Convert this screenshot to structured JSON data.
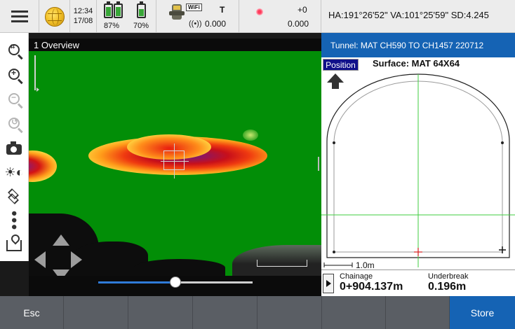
{
  "statusbar": {
    "time": "12:34",
    "date": "17/08",
    "battery1": {
      "label": "87%",
      "level": 0.87
    },
    "battery2": {
      "label": "70%",
      "level": 0.7
    },
    "wifi_tag": "WiFi",
    "t_label": "T",
    "t_value": "0.000",
    "plus_label": "+0",
    "offset_value": "0.000",
    "angles": "HA:191°26'52\"  VA:101°25'59\"  SD:4.245"
  },
  "toolbar": {
    "icons": [
      "zoom-extents-icon",
      "zoom-in-icon",
      "zoom-out-icon",
      "zoom-previous-icon",
      "camera-icon",
      "brightness-icon",
      "layers-icon",
      "more-icon",
      "map-icon"
    ]
  },
  "viewport": {
    "title": "1 Overview",
    "slider_value": 0.5
  },
  "right_panel": {
    "tunnel_title": "Tunnel: MAT CH590 TO CH1457 220712",
    "position_button": "Position",
    "surface_label": "Surface: MAT 64X64",
    "scale_label": "1.0m",
    "chainage_label": "Chainage",
    "chainage_value": "0+904.137m",
    "underbreak_label": "Underbreak",
    "underbreak_value": "0.196m"
  },
  "bottombar": {
    "esc_label": "Esc",
    "store_label": "Store"
  },
  "colors": {
    "accent": "#1563b4",
    "scan_background": "#028e07",
    "status_background": "#ececec"
  }
}
